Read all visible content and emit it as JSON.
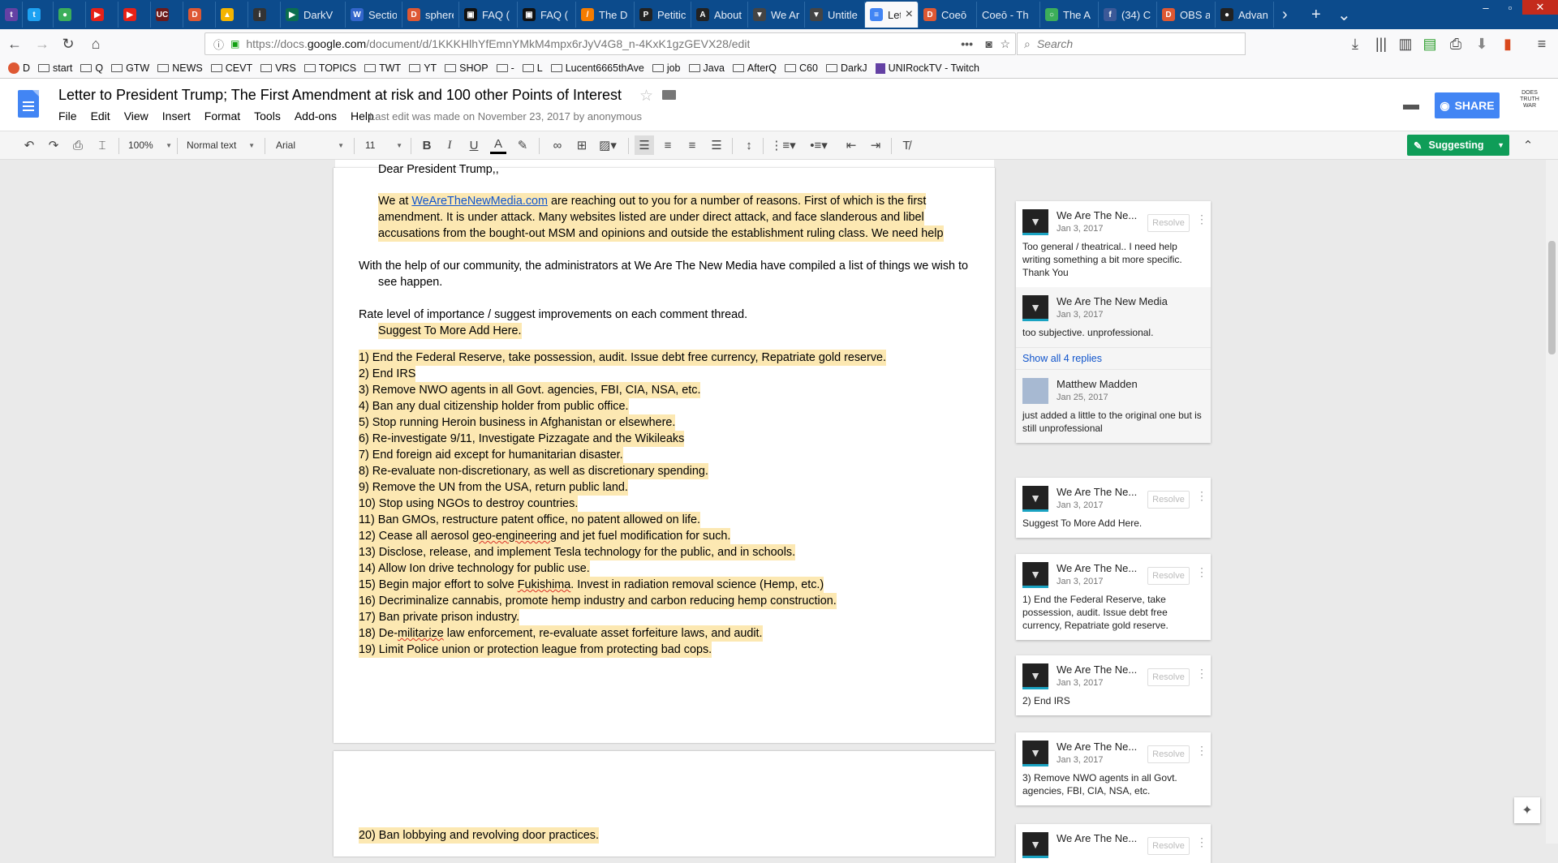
{
  "browser": {
    "tabs": [
      {
        "label": "",
        "fav": "twitch-icon",
        "color": "#6441a4",
        "glyph": "t"
      },
      {
        "label": "",
        "fav": "twitter-icon",
        "color": "#1da1f2",
        "glyph": "t"
      },
      {
        "label": "",
        "fav": "frog-icon",
        "color": "#3cae5a",
        "glyph": "●"
      },
      {
        "label": "",
        "fav": "youtube-icon",
        "color": "#e62117",
        "glyph": "▶"
      },
      {
        "label": "",
        "fav": "youtube-icon",
        "color": "#e62117",
        "glyph": "▶"
      },
      {
        "label": "",
        "fav": "uc-icon",
        "color": "#6b1a1a",
        "glyph": "UC"
      },
      {
        "label": "",
        "fav": "duckduckgo-icon",
        "color": "#de5833",
        "glyph": "D"
      },
      {
        "label": "",
        "fav": "drive-icon",
        "color": "#f4b400",
        "glyph": "▲"
      },
      {
        "label": "",
        "fav": "info-icon",
        "color": "#333333",
        "glyph": "i"
      },
      {
        "label": "DarkV",
        "fav": "play-icon",
        "color": "#0b6e4f",
        "glyph": "▶"
      },
      {
        "label": "Sectio",
        "fav": "wiki-icon",
        "color": "#3366cc",
        "glyph": "W"
      },
      {
        "label": "sphere",
        "fav": "duckduckgo-icon",
        "color": "#de5833",
        "glyph": "D"
      },
      {
        "label": "FAQ (",
        "fav": "terminal-icon",
        "color": "#111111",
        "glyph": "▣"
      },
      {
        "label": "FAQ (",
        "fav": "terminal-icon",
        "color": "#111111",
        "glyph": "▣"
      },
      {
        "label": "The D",
        "fav": "slash-icon",
        "color": "#f57c00",
        "glyph": "/"
      },
      {
        "label": "Petitic",
        "fav": "petition-icon",
        "color": "#222222",
        "glyph": "P"
      },
      {
        "label": "About",
        "fav": "about-icon",
        "color": "#222222",
        "glyph": "A"
      },
      {
        "label": "We Ar",
        "fav": "shield-icon",
        "color": "#444444",
        "glyph": "▼"
      },
      {
        "label": "Untitle",
        "fav": "shield-icon",
        "color": "#444444",
        "glyph": "▼"
      },
      {
        "label": "Let",
        "fav": "docs-icon",
        "color": "#4285f4",
        "glyph": "≡"
      },
      {
        "label": "Coeō",
        "fav": "duckduckgo-icon",
        "color": "#de5833",
        "glyph": "D"
      },
      {
        "label": "Coeō - Th",
        "fav": "",
        "color": "",
        "glyph": ""
      },
      {
        "label": "The A",
        "fav": "circle-icon",
        "color": "#3cae5a",
        "glyph": "○"
      },
      {
        "label": "(34) C",
        "fav": "facebook-icon",
        "color": "#3b5998",
        "glyph": "f"
      },
      {
        "label": "OBS a",
        "fav": "duckduckgo-icon",
        "color": "#de5833",
        "glyph": "D"
      },
      {
        "label": "Advan",
        "fav": "github-icon",
        "color": "#222222",
        "glyph": "●"
      }
    ],
    "url_prefix": "https://docs.",
    "url_host": "google.com",
    "url_path": "/document/d/1KKKHlhYfEmnYMkM4mpx6rJyV4G8_n-4KxK1gzGEVX28/edit",
    "search_placeholder": "Search",
    "bookmarks": [
      "D",
      "start",
      "Q",
      "GTW",
      "NEWS",
      "CEVT",
      "VRS",
      "TOPICS",
      "TWT",
      "YT",
      "SHOP",
      "-",
      "L",
      "Lucent6665thAve",
      "job",
      "Java",
      "AfterQ",
      "C60",
      "DarkJ",
      "UNIRockTV - Twitch"
    ]
  },
  "doc": {
    "title": "Letter to President Trump; The First Amendment at risk and 100 other Points of Interest",
    "menus": [
      "File",
      "Edit",
      "View",
      "Insert",
      "Format",
      "Tools",
      "Add-ons",
      "Help"
    ],
    "last_edit": "Last edit was made on November 23, 2017 by anonymous",
    "share_label": "SHARE",
    "logo_text": "DOES TRUTH WAR"
  },
  "toolbar": {
    "zoom": "100%",
    "style": "Normal text",
    "font": "Arial",
    "size": "11",
    "mode": "Suggesting"
  },
  "body": {
    "salutation": "Dear President Trump,,",
    "intro_prefix": "We at ",
    "intro_link": "WeAreTheNewMedia.com",
    "intro_line1_rest": " are reaching out to you for a number of reasons. First of which is the first",
    "intro_line2": "amendment. It is under attack. Many websites listed are under direct attack, and face slanderous and libel",
    "intro_line3": "accusations from the bought-out MSM and opinions and outside the establishment ruling class. We need help",
    "help_line1": "With the help of our community, the administrators at We Are The New Media have compiled a list of things we wish to",
    "help_line2": "see happen.",
    "rate_line": "Rate level of importance / suggest improvements on each comment thread.",
    "suggest_line": "Suggest To More Add Here.",
    "items": [
      "1) End the Federal Reserve, take possession, audit. Issue debt free currency, Repatriate gold reserve.",
      "2) End IRS",
      "3) Remove NWO agents in all Govt. agencies, FBI, CIA, NSA, etc.",
      "4) Ban any dual citizenship holder from public office.",
      "5) Stop running Heroin business in Afghanistan or elsewhere.",
      "6) Re-investigate 9/11, Investigate Pizzagate and the Wikileaks",
      "7) End foreign aid except for humanitarian disaster.",
      "8) Re-evaluate non-discretionary, as well as discretionary spending.",
      "9) Remove the UN from the USA, return public land.",
      "10) Stop using NGOs to destroy countries.",
      "11) Ban GMOs, restructure patent office, no patent allowed on life.",
      "12) Cease all aerosol geo-engineering and jet fuel modification for such.",
      "13) Disclose, release, and implement Tesla technology for the public, and in schools.",
      "14) Allow Ion drive technology for public use.",
      "15) Begin major effort to solve Fukishima. Invest in radiation removal science (Hemp, etc.)",
      "16) Decriminalize cannabis, promote hemp industry and carbon reducing hemp construction.",
      "17) Ban private prison industry.",
      "18) De-militarize law enforcement, re-evaluate asset forfeiture laws, and audit.",
      "19) Limit Police union or protection league from protecting bad cops."
    ],
    "page2_item": "20) Ban lobbying and revolving door practices."
  },
  "comments": [
    {
      "name": "We Are The Ne...",
      "date": "Jan 3, 2017",
      "text": "Too general / theatrical.. I need help writing something a bit more specific. Thank You",
      "resolve": "Resolve",
      "reply_name": "We Are The New Media",
      "reply_date": "Jan 3, 2017",
      "reply_text": "too subjective. unprofessional.",
      "show_replies": "Show all 4 replies",
      "reply2_name": "Matthew Madden",
      "reply2_date": "Jan 25, 2017",
      "reply2_text": "just added a little to the original one but is still unprofessional"
    },
    {
      "name": "We Are The Ne...",
      "date": "Jan 3, 2017",
      "text": "Suggest To More Add Here.",
      "resolve": "Resolve"
    },
    {
      "name": "We Are The Ne...",
      "date": "Jan 3, 2017",
      "text": "1) End the Federal Reserve, take possession, audit. Issue debt free currency, Repatriate gold reserve.",
      "resolve": "Resolve"
    },
    {
      "name": "We Are The Ne...",
      "date": "Jan 3, 2017",
      "text": "2) End IRS",
      "resolve": "Resolve"
    },
    {
      "name": "We Are The Ne...",
      "date": "Jan 3, 2017",
      "text": "3) Remove NWO agents in all Govt. agencies, FBI, CIA, NSA, etc.",
      "resolve": "Resolve"
    },
    {
      "name": "We Are The Ne...",
      "date": "",
      "text": "",
      "resolve": "Resolve"
    }
  ],
  "colors": {
    "highlight": "#fce8b2",
    "share": "#4285f4",
    "suggesting": "#0f9d58",
    "tabbar": "#0c4b8c"
  }
}
